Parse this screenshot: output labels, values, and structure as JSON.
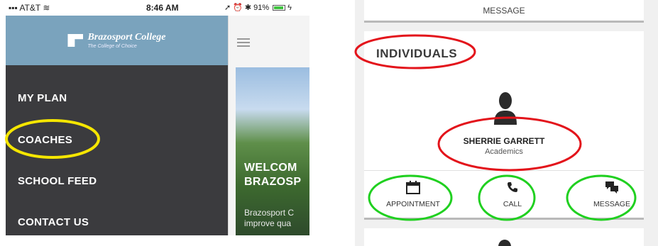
{
  "status_bar": {
    "carrier": "AT&T",
    "time": "8:46 AM",
    "battery": "91%"
  },
  "left_screen": {
    "logo": {
      "name": "Brazosport College",
      "tagline": "The College of Choice"
    },
    "menu_items": [
      {
        "label": "MY PLAN"
      },
      {
        "label": "COACHES"
      },
      {
        "label": "SCHOOL FEED"
      },
      {
        "label": "CONTACT US"
      }
    ],
    "hero": {
      "title_line1": "WELCOM",
      "title_line2": "BRAZOSP",
      "body_line1": "Brazosport C",
      "body_line2": "improve qua"
    }
  },
  "right_screen": {
    "top_card_label": "MESSAGE",
    "section_title": "INDIVIDUALS",
    "person": {
      "name": "SHERRIE GARRETT",
      "department": "Academics"
    },
    "actions": [
      {
        "label": "APPOINTMENT",
        "icon": "calendar-icon"
      },
      {
        "label": "CALL",
        "icon": "phone-icon"
      },
      {
        "label": "MESSAGE",
        "icon": "chat-bubbles-icon"
      }
    ]
  },
  "annotations": {
    "yellow": "#f5e600",
    "red": "#e3141b",
    "green": "#20d020"
  }
}
